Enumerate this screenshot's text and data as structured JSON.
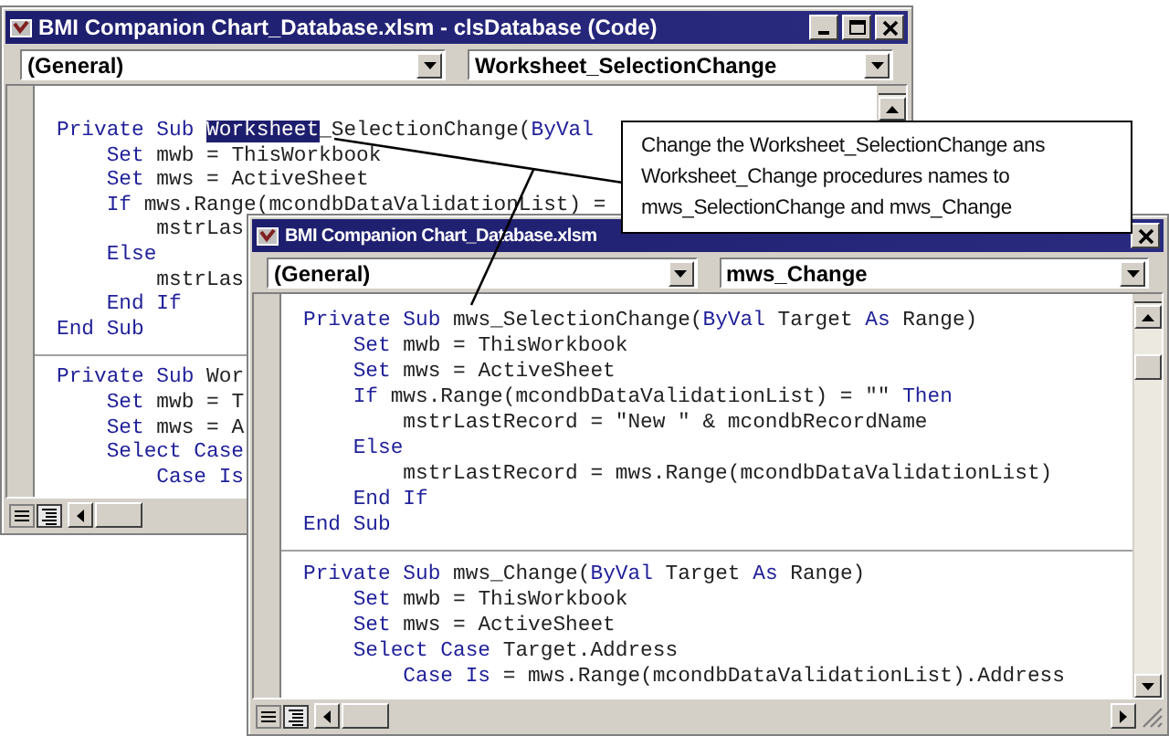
{
  "windows": [
    {
      "title": "BMI Companion Chart_Database.xlsm - clsDatabase (Code)",
      "title_buttons": [
        {
          "kind": "minimize"
        },
        {
          "kind": "maximize"
        },
        {
          "kind": "close"
        }
      ],
      "dropdowns": [
        {
          "value": "(General)"
        },
        {
          "value": "Worksheet_SelectionChange"
        }
      ],
      "procedures": [
        {
          "lines": [
            {
              "kind": "declaration",
              "parts": [
                {
                  "text": "Private Sub ",
                  "kind": "keyword"
                },
                {
                  "text": "Worksheet",
                  "kind": "selected"
                },
                {
                  "text": "_SelectionChange(",
                  "kind": "plain"
                },
                {
                  "text": "ByVal",
                  "kind": "keyword"
                }
              ]
            },
            {
              "kind": "statement",
              "parts": [
                {
                  "text": "Set",
                  "kind": "keyword"
                },
                {
                  "text": " mwb = ThisWorkbook",
                  "kind": "plain"
                }
              ]
            },
            {
              "kind": "statement",
              "parts": [
                {
                  "text": "Set",
                  "kind": "keyword"
                },
                {
                  "text": " mws = ActiveSheet",
                  "kind": "plain"
                }
              ]
            },
            {
              "kind": "statement",
              "parts": [
                {
                  "text": "If",
                  "kind": "keyword"
                },
                {
                  "text": " mws.Range(mcondbDataValidationList) =",
                  "kind": "plain"
                }
              ]
            },
            {
              "kind": "nested",
              "parts": [
                {
                  "text": "mstrLas",
                  "kind": "plain"
                }
              ]
            },
            {
              "kind": "statement",
              "parts": [
                {
                  "text": "Else",
                  "kind": "keyword"
                }
              ]
            },
            {
              "kind": "nested",
              "parts": [
                {
                  "text": "mstrLas",
                  "kind": "plain"
                }
              ]
            },
            {
              "kind": "statement",
              "parts": [
                {
                  "text": "End If",
                  "kind": "keyword"
                }
              ]
            },
            {
              "kind": "declaration",
              "parts": [
                {
                  "text": "End Sub",
                  "kind": "keyword"
                }
              ]
            }
          ]
        },
        {
          "lines": [
            {
              "kind": "declaration",
              "parts": [
                {
                  "text": "Private Sub ",
                  "kind": "keyword"
                },
                {
                  "text": "Wor",
                  "kind": "plain"
                }
              ]
            },
            {
              "kind": "statement",
              "parts": [
                {
                  "text": "Set",
                  "kind": "keyword"
                },
                {
                  "text": " mwb = T",
                  "kind": "plain"
                }
              ]
            },
            {
              "kind": "statement",
              "parts": [
                {
                  "text": "Set",
                  "kind": "keyword"
                },
                {
                  "text": " mws = A",
                  "kind": "plain"
                }
              ]
            },
            {
              "kind": "statement",
              "parts": [
                {
                  "text": "Select Case",
                  "kind": "keyword"
                }
              ]
            },
            {
              "kind": "nested",
              "parts": [
                {
                  "text": "Case Is",
                  "kind": "keyword"
                }
              ]
            }
          ]
        }
      ]
    },
    {
      "title": "BMI Companion Chart_Database.xlsm",
      "title_buttons": [
        {
          "kind": "close"
        }
      ],
      "dropdowns": [
        {
          "value": "(General)"
        },
        {
          "value": "mws_Change"
        }
      ],
      "procedures": [
        {
          "lines": [
            {
              "kind": "declaration",
              "parts": [
                {
                  "text": "Private Sub ",
                  "kind": "keyword"
                },
                {
                  "text": "mws_SelectionChange(",
                  "kind": "plain"
                },
                {
                  "text": "ByVal",
                  "kind": "keyword"
                },
                {
                  "text": " Target ",
                  "kind": "plain"
                },
                {
                  "text": "As",
                  "kind": "keyword"
                },
                {
                  "text": " Range)",
                  "kind": "plain"
                }
              ]
            },
            {
              "kind": "statement",
              "parts": [
                {
                  "text": "Set",
                  "kind": "keyword"
                },
                {
                  "text": " mwb = ThisWorkbook",
                  "kind": "plain"
                }
              ]
            },
            {
              "kind": "statement",
              "parts": [
                {
                  "text": "Set",
                  "kind": "keyword"
                },
                {
                  "text": " mws = ActiveSheet",
                  "kind": "plain"
                }
              ]
            },
            {
              "kind": "statement",
              "parts": [
                {
                  "text": "If",
                  "kind": "keyword"
                },
                {
                  "text": " mws.Range(mcondbDataValidationList) = \"\" ",
                  "kind": "plain"
                },
                {
                  "text": "Then",
                  "kind": "keyword"
                }
              ]
            },
            {
              "kind": "nested",
              "parts": [
                {
                  "text": "mstrLastRecord = \"New \" & mcondbRecordName",
                  "kind": "plain"
                }
              ]
            },
            {
              "kind": "statement",
              "parts": [
                {
                  "text": "Else",
                  "kind": "keyword"
                }
              ]
            },
            {
              "kind": "nested",
              "parts": [
                {
                  "text": "mstrLastRecord = mws.Range(mcondbDataValidationList)",
                  "kind": "plain"
                }
              ]
            },
            {
              "kind": "statement",
              "parts": [
                {
                  "text": "End If",
                  "kind": "keyword"
                }
              ]
            },
            {
              "kind": "declaration",
              "parts": [
                {
                  "text": "End Sub",
                  "kind": "keyword"
                }
              ]
            }
          ]
        },
        {
          "lines": [
            {
              "kind": "declaration",
              "parts": [
                {
                  "text": "Private Sub ",
                  "kind": "keyword"
                },
                {
                  "text": "mws_Change(",
                  "kind": "plain"
                },
                {
                  "text": "ByVal",
                  "kind": "keyword"
                },
                {
                  "text": " Target ",
                  "kind": "plain"
                },
                {
                  "text": "As",
                  "kind": "keyword"
                },
                {
                  "text": " Range)",
                  "kind": "plain"
                }
              ]
            },
            {
              "kind": "statement",
              "parts": [
                {
                  "text": "Set",
                  "kind": "keyword"
                },
                {
                  "text": " mwb = ThisWorkbook",
                  "kind": "plain"
                }
              ]
            },
            {
              "kind": "statement",
              "parts": [
                {
                  "text": "Set",
                  "kind": "keyword"
                },
                {
                  "text": " mws = ActiveSheet",
                  "kind": "plain"
                }
              ]
            },
            {
              "kind": "statement",
              "parts": [
                {
                  "text": "Select Case",
                  "kind": "keyword"
                },
                {
                  "text": " Target.Address",
                  "kind": "plain"
                }
              ]
            },
            {
              "kind": "nested",
              "parts": [
                {
                  "text": "Case Is",
                  "kind": "keyword"
                },
                {
                  "text": " = mws.Range(mcondbDataValidationList).Address",
                  "kind": "plain"
                }
              ]
            }
          ]
        }
      ]
    }
  ],
  "callout": {
    "text": "Change the Worksheet_SelectionChange ans\nWorksheet_Change procedures names to\nmws_SelectionChange and mws_Change"
  }
}
